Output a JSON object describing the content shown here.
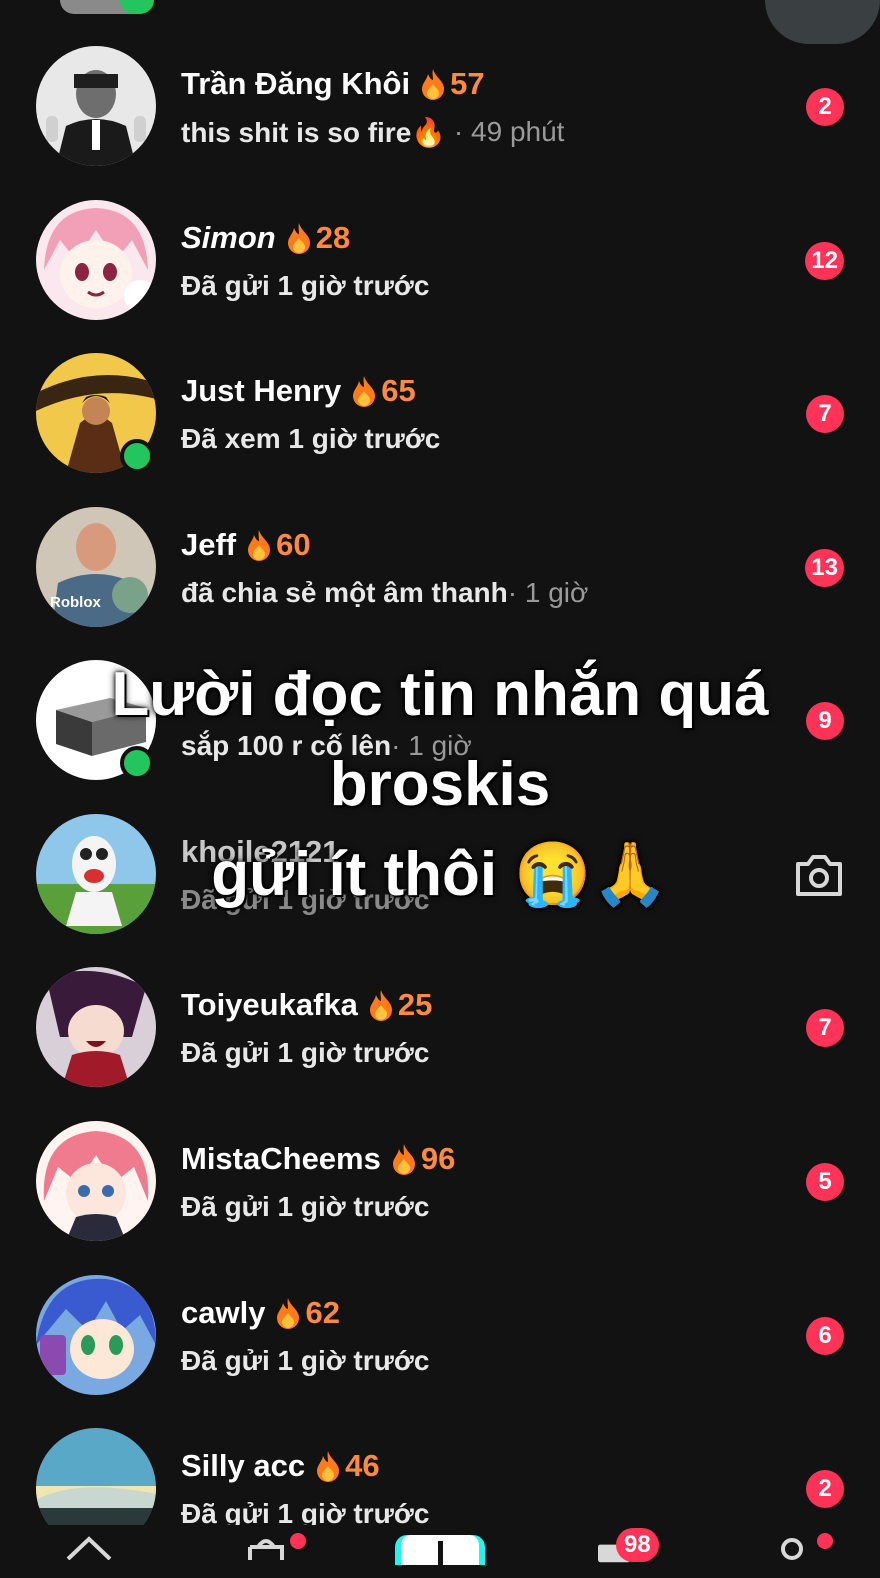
{
  "chats": [
    {
      "name": "Trần Đăng Khôi",
      "streak": "57",
      "message": "this shit is so fire🔥",
      "time": "· 49 phút",
      "badge": "2",
      "online": false
    },
    {
      "name": "Simon",
      "streak": "28",
      "message": "Đã gửi 1 giờ trước",
      "time": "",
      "badge": "12",
      "online": false
    },
    {
      "name": "Just Henry",
      "streak": "65",
      "message": "Đã xem 1 giờ trước",
      "time": "",
      "badge": "7",
      "online": true
    },
    {
      "name": "Jeff",
      "streak": "60",
      "message": "đã chia sẻ một âm thanh",
      "time": " · 1 giờ",
      "badge": "13",
      "online": false
    },
    {
      "name": "",
      "streak": "",
      "message": "sắp 100 r cố lên",
      "time": " · 1 giờ",
      "badge": "9",
      "online": true
    },
    {
      "name": "khoile2121",
      "streak": "",
      "message": "Đã gửi 1 giờ trước",
      "time": "",
      "badge": "",
      "online": false
    },
    {
      "name": "Toiyeukafka",
      "streak": "25",
      "message": "Đã gửi 1 giờ trước",
      "time": "",
      "badge": "7",
      "online": false
    },
    {
      "name": "MistaCheems",
      "streak": "96",
      "message": "Đã gửi 1 giờ trước",
      "time": "",
      "badge": "5",
      "online": false
    },
    {
      "name": "cawly",
      "streak": "62",
      "message": "Đã gửi 1 giờ trước",
      "time": "",
      "badge": "6",
      "online": false
    },
    {
      "name": "Silly acc",
      "streak": "46",
      "message": "Đã gửi 1 giờ trước",
      "time": "",
      "badge": "2",
      "online": false
    }
  ],
  "avatar_labels": {
    "jeff": "Roblox"
  },
  "overlay": {
    "line1": "Lười đọc tin nhắn quá",
    "line2": "broskis",
    "line3": "gửi ít thôi 😭🙏"
  },
  "nav": {
    "inbox_badge": "98"
  },
  "icons": {
    "streak": "flame-icon",
    "camera": "camera-icon"
  },
  "colors": {
    "background": "#121212",
    "badge": "#ff3358",
    "streak": "#ff8a3d",
    "online": "#22c55e"
  }
}
